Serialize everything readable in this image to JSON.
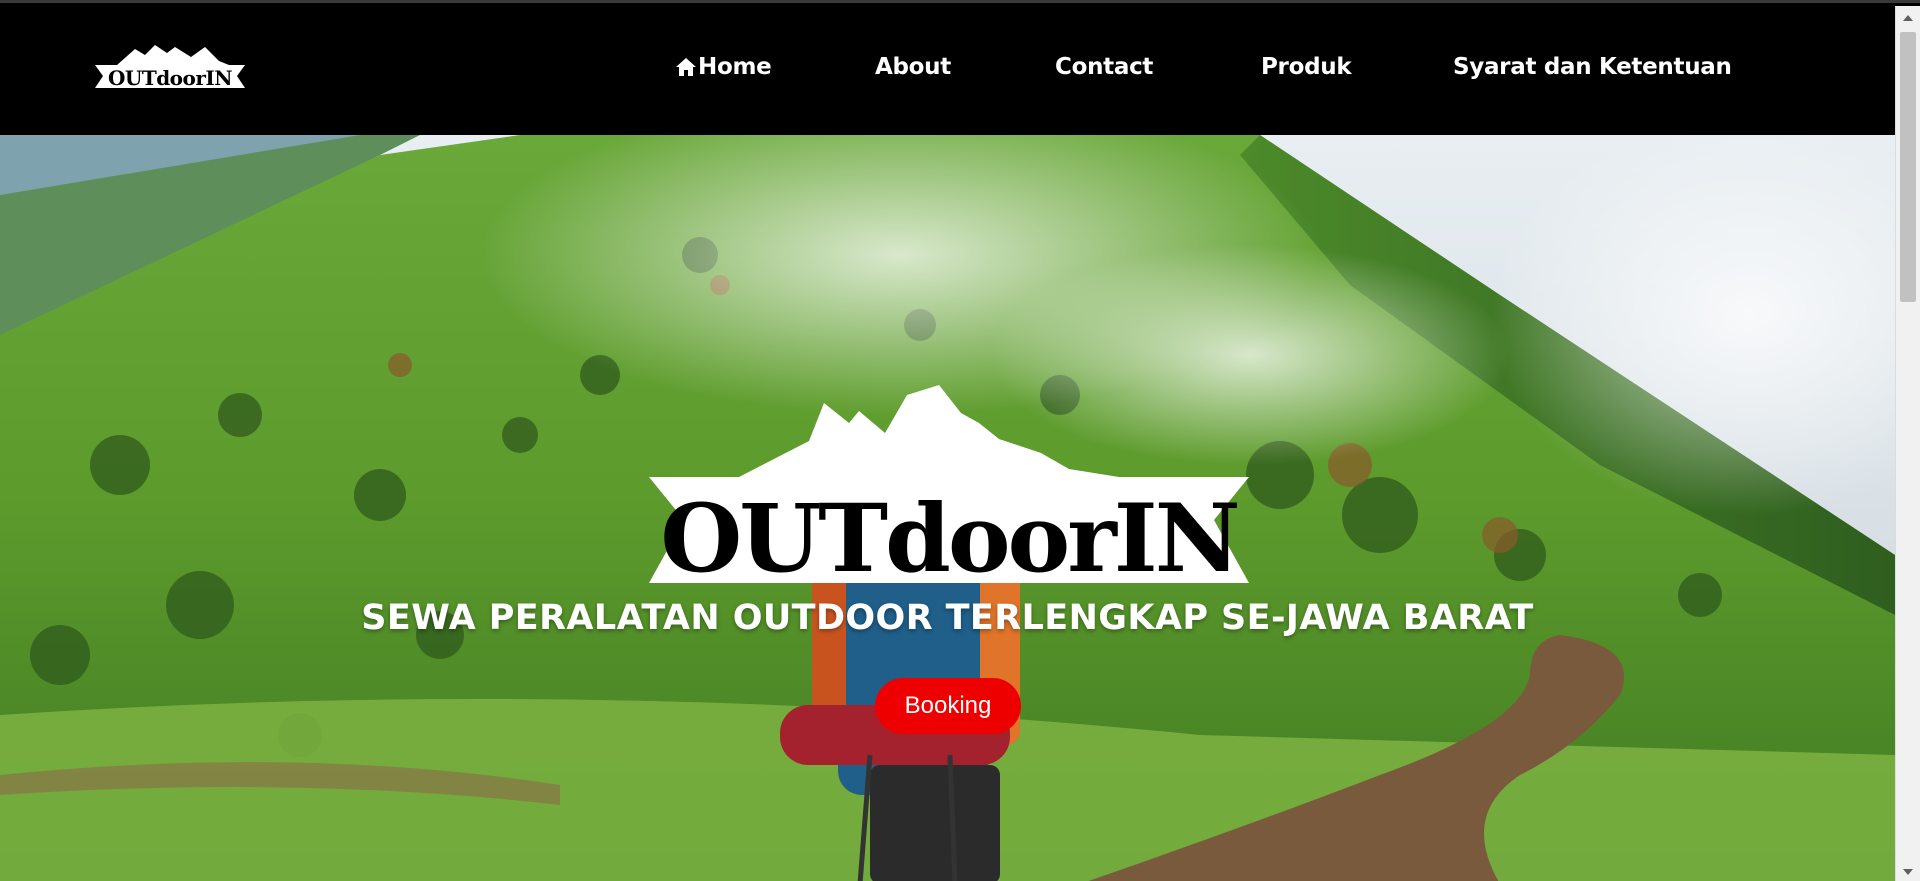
{
  "brand": {
    "logo_text": "OUTdoorIN"
  },
  "nav": {
    "items": [
      {
        "label": "Home",
        "icon": "home-icon"
      },
      {
        "label": "About"
      },
      {
        "label": "Contact"
      },
      {
        "label": "Produk"
      },
      {
        "label": "Syarat dan Ketentuan"
      }
    ]
  },
  "hero": {
    "logo_text": "OUTdoorIN",
    "tagline": "SEWA PERALATAN OUTDOOR TERLENGKAP SE-JAWA BARAT",
    "booking_label": "Booking"
  },
  "colors": {
    "navbar_bg": "#000000",
    "accent": "#ee0000",
    "text_on_dark": "#ffffff"
  }
}
